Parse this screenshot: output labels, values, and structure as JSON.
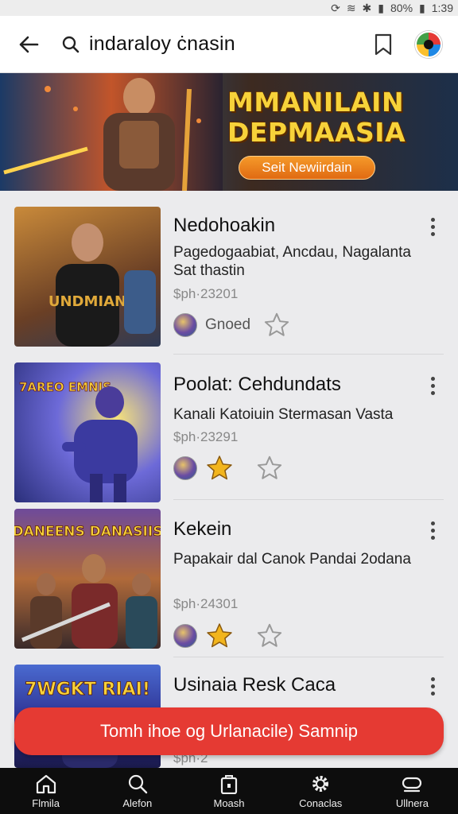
{
  "status_bar": {
    "battery": "80%",
    "time": "1:39"
  },
  "search": {
    "query": "indaraloy ċnasin"
  },
  "banner": {
    "title_line1": "MMANILAIN",
    "title_line2": "DEPMAASIA",
    "cta": "Seit Newiirdain"
  },
  "results": [
    {
      "title": "Nedohoakin",
      "description": "Pagedogaabiat, Ancdau, Nagalanta Sat thastin",
      "meta": "$ph·23201",
      "action_label": "Gnoed",
      "has_star": false
    },
    {
      "title": "Poolat: Cehdundats",
      "description": "Kanali Katoiuin Stermasan Vasta",
      "meta": "$ph·23291",
      "action_label": "",
      "has_star": true
    },
    {
      "title": "Kekein",
      "description": "Papakair dal Canok Pandai 2odana",
      "meta": "$ph·24301",
      "action_label": "",
      "has_star": true
    },
    {
      "title": "Usinaia Resk Caca",
      "description": "",
      "meta": "$ph·2",
      "action_label": "",
      "has_star": false
    }
  ],
  "thumbs": [
    {
      "text": "UNDMIAN"
    },
    {
      "text": "7AREO EMNIS"
    },
    {
      "text": "DANEENS DANASIIS"
    },
    {
      "text": "7WGKT RIAI!"
    }
  ],
  "cta_bar": {
    "label": "Tomh ihoe og Urlanacile) Samnip"
  },
  "bottom_nav": [
    {
      "label": "Flmila",
      "icon": "home-icon"
    },
    {
      "label": "Alefon",
      "icon": "search-icon"
    },
    {
      "label": "Moash",
      "icon": "bag-icon"
    },
    {
      "label": "Conaclas",
      "icon": "gear-icon"
    },
    {
      "label": "Ullnera",
      "icon": "controller-icon"
    }
  ],
  "colors": {
    "accent_red": "#e53a33",
    "star_gold": "#f2b51d",
    "banner_title": "#f7d23a"
  }
}
